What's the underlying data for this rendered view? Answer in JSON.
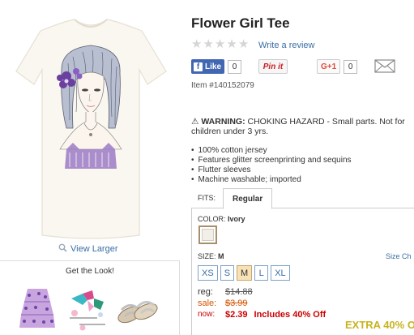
{
  "product": {
    "title": "Flower Girl Tee",
    "rating_stars": 0,
    "write_review": "Write a review",
    "item_number": "Item #140152079"
  },
  "social": {
    "like_label": "Like",
    "like_count": "0",
    "pinit_label": "Pin it",
    "gplus_label": "G+1",
    "gplus_count": "0"
  },
  "warning": {
    "prefix": "WARNING:",
    "text": "CHOKING HAZARD - Small parts. Not for children under 3 yrs."
  },
  "features": [
    "100% cotton jersey",
    "Features glitter screenprinting and sequins",
    "Flutter sleeves",
    "Machine washable; imported"
  ],
  "fits": {
    "label": "FITS:",
    "selected_tab": "Regular"
  },
  "color": {
    "label": "COLOR:",
    "value": "Ivory",
    "swatch_color": "#f3efe6"
  },
  "size": {
    "label": "SIZE:",
    "value": "M",
    "chart_link": "Size Ch",
    "options": [
      "XS",
      "S",
      "M",
      "L",
      "XL"
    ],
    "selected": "M"
  },
  "prices": {
    "reg_label": "reg:",
    "reg_value": "$14.88",
    "sale_label": "sale:",
    "sale_value": "$3.99",
    "now_label": "now:",
    "now_value": "$2.39",
    "now_note": "Includes 40% Off"
  },
  "promo": {
    "extra": "EXTRA 40% O"
  },
  "left": {
    "view_larger": "View Larger",
    "get_the_look": "Get the Look!"
  },
  "colors": {
    "link": "#3a6ea5",
    "price_red": "#cc0000",
    "sale_orange": "#d35400",
    "promo_gold": "#c8b31f",
    "facebook_blue": "#4267b2"
  }
}
